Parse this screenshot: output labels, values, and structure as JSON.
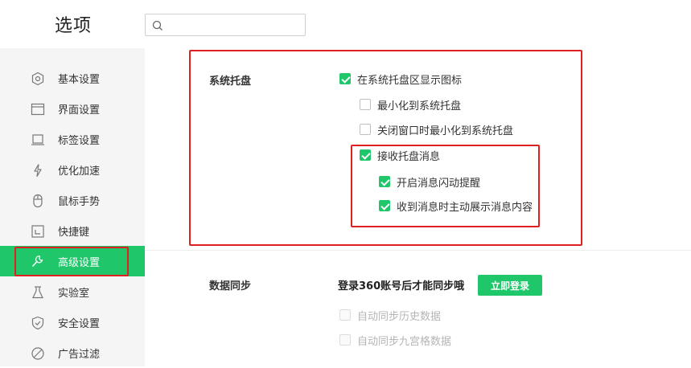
{
  "header": {
    "title": "选项",
    "search": {
      "value": "",
      "placeholder": ""
    }
  },
  "sidebar": {
    "items": [
      {
        "label": "基本设置",
        "icon": "hexagon-gear-icon"
      },
      {
        "label": "界面设置",
        "icon": "window-icon"
      },
      {
        "label": "标签设置",
        "icon": "tab-icon"
      },
      {
        "label": "优化加速",
        "icon": "lightning-icon"
      },
      {
        "label": "鼠标手势",
        "icon": "mouse-icon"
      },
      {
        "label": "快捷键",
        "icon": "keyboard-shortcut-icon"
      },
      {
        "label": "高级设置",
        "icon": "wrench-icon",
        "active": true
      },
      {
        "label": "实验室",
        "icon": "flask-icon"
      },
      {
        "label": "安全设置",
        "icon": "shield-icon"
      },
      {
        "label": "广告过滤",
        "icon": "block-icon"
      }
    ]
  },
  "tray": {
    "title": "系统托盘",
    "options": [
      {
        "label": "在系统托盘区显示图标",
        "checked": true
      },
      {
        "label": "最小化到系统托盘",
        "checked": false
      },
      {
        "label": "关闭窗口时最小化到系统托盘",
        "checked": false
      },
      {
        "label": "接收托盘消息",
        "checked": true
      },
      {
        "label": "开启消息闪动提醒",
        "checked": true
      },
      {
        "label": "收到消息时主动展示消息内容",
        "checked": true
      }
    ]
  },
  "sync": {
    "title": "数据同步",
    "prompt": "登录360账号后才能同步哦",
    "login_button": "立即登录",
    "options": [
      {
        "label": "自动同步历史数据",
        "checked": false,
        "disabled": true
      },
      {
        "label": "自动同步九宫格数据",
        "checked": false,
        "disabled": true
      }
    ]
  },
  "colors": {
    "accent": "#1fc76a",
    "annotation": "#e02020",
    "sidebar_bg": "#f5f5f5"
  }
}
